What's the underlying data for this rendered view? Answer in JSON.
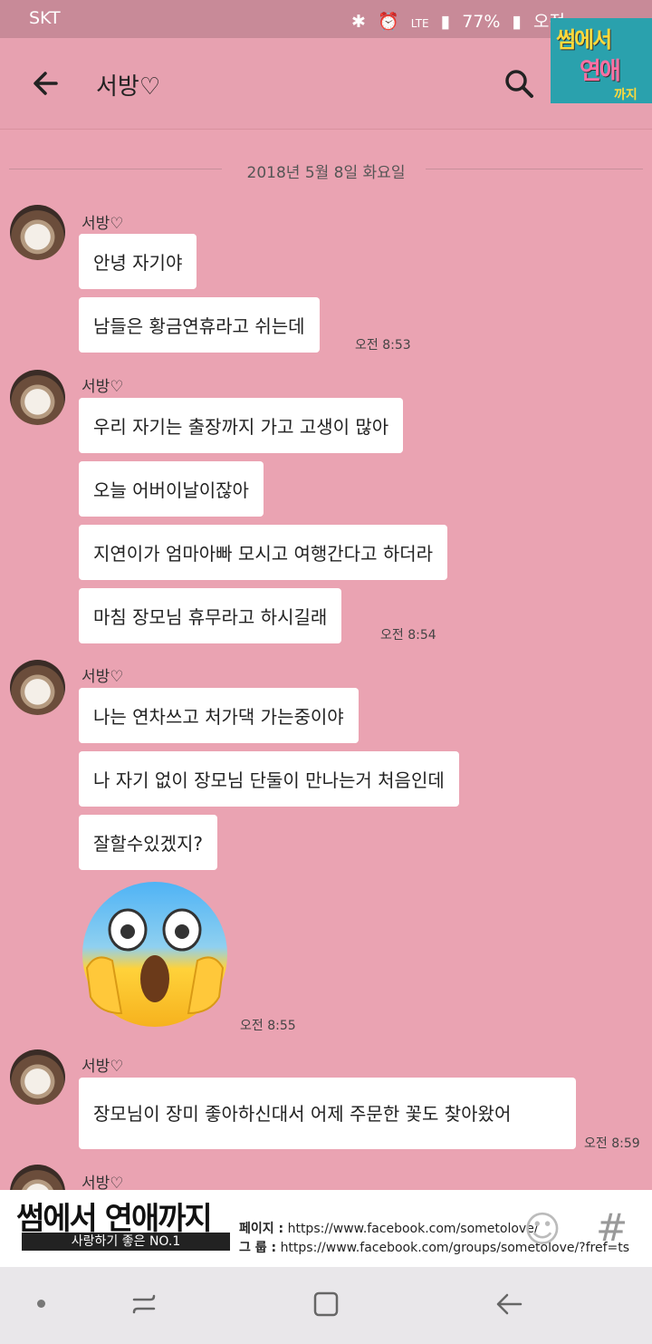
{
  "status_bar": {
    "carrier": "SKT",
    "network": "LTE",
    "battery": "77%",
    "time_partial": "오전"
  },
  "header": {
    "title": "서방♡"
  },
  "date_divider": "2018년 5월 8일 화요일",
  "messages": {
    "g1": {
      "sender": "서방♡",
      "b1": "안녕 자기야",
      "b2": "남들은 황금연휴라고 쉬는데",
      "time": "오전 8:53"
    },
    "g2": {
      "sender": "서방♡",
      "b1": "우리 자기는 출장까지 가고 고생이 많아",
      "b2": "오늘 어버이날이잖아",
      "b3": "지연이가 엄마아빠 모시고 여행간다고 하더라",
      "b4": "마침 장모님 휴무라고 하시길래",
      "time": "오전 8:54"
    },
    "g3": {
      "sender": "서방♡",
      "b1": "나는 연차쓰고 처가댁 가는중이야",
      "b2": "나 자기 없이 장모님 단둘이 만나는거 처음인데",
      "b3": "잘할수있겠지?",
      "emoji": "scared-face-emoji",
      "time": "오전 8:55"
    },
    "g4": {
      "sender": "서방♡",
      "b1": "장모님이 장미 좋아하신대서 어제 주문한 꽃도 찾아왔어",
      "time": "오전 8:59"
    },
    "g5": {
      "sender": "서방♡"
    }
  },
  "banner": {
    "logo": "썸에서 연애까지",
    "title": "썸에서 연애까지",
    "subtitle": "사랑하기 좋은 NO.1",
    "page_label": "페이지 :",
    "page_url": "https://www.facebook.com/sometolove/",
    "group_label": "그   룹 :",
    "group_url": "https://www.facebook.com/groups/sometolove/?fref=ts"
  },
  "colors": {
    "chat_bg": "#eaa3b2",
    "bubble": "#ffffff",
    "accent_badge": "#2aa1ad"
  }
}
